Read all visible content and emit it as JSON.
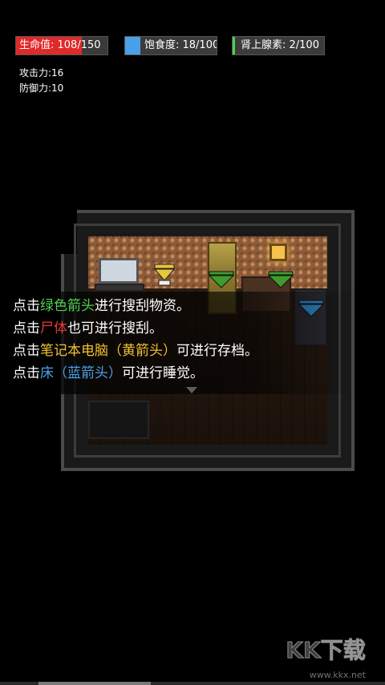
{
  "hud": {
    "hp": {
      "label": "生命值: 108/150",
      "current": 108,
      "max": 150,
      "color": "#e02a2a"
    },
    "hunger": {
      "label": "饱食度: 18/100",
      "current": 18,
      "max": 100,
      "color": "#4aa0e8"
    },
    "adrenaline": {
      "label": "肾上腺素: 2/100",
      "current": 2,
      "max": 100,
      "color": "#4fd04f"
    }
  },
  "stats": {
    "attack": "攻击力:16",
    "defense": "防御力:10"
  },
  "tutorial": {
    "line1": {
      "p1": "点击",
      "hl": "绿色箭头",
      "p2": "进行搜刮物资。",
      "hl_color": "#4fd04f"
    },
    "line2": {
      "p1": "点击",
      "hl": "尸体",
      "p2": "也可进行搜刮。",
      "hl_color": "#e53935"
    },
    "line3": {
      "p1": "点击",
      "hl": "笔记本电脑（黄箭头）",
      "p2": "可进行存档。",
      "hl_color": "#f2c230"
    },
    "line4": {
      "p1": "点击",
      "hl": "床（蓝箭头）",
      "p2": "可进行睡觉。",
      "hl_color": "#4aa0e8"
    }
  },
  "arrow_colors": {
    "green": "#3e9b2c",
    "yellow": "#e8c63a",
    "blue": "#2f86c8"
  },
  "watermark": {
    "logo": "KK下载",
    "url": "www.kkx.net"
  }
}
